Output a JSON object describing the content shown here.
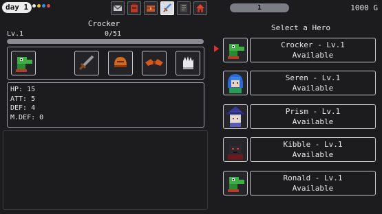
{
  "topbar": {
    "day_label": "day 1",
    "dot_colors": [
      "#e8e8e8",
      "#f2c230",
      "#3a8ee6",
      "#d84848"
    ],
    "tabs": [
      {
        "icon": "mail-icon",
        "active": false
      },
      {
        "icon": "backpack-icon",
        "active": false
      },
      {
        "icon": "chest-icon",
        "active": false
      },
      {
        "icon": "sword-icon",
        "active": true
      },
      {
        "icon": "notebook-icon",
        "active": false
      },
      {
        "icon": "house-icon",
        "active": false
      }
    ],
    "progress_value": "1",
    "gold": "1000 G"
  },
  "hero": {
    "name": "Crocker",
    "level": "Lv.1",
    "xp": "0/51",
    "portrait_icon": "crocodile-portrait-icon",
    "equipment": [
      {
        "icon": "sword-icon"
      },
      {
        "icon": "helmet-icon"
      },
      {
        "icon": "wing-armor-icon"
      },
      {
        "icon": "glove-icon"
      }
    ],
    "stats": [
      {
        "text": "HP: 15"
      },
      {
        "text": "ATT: 5"
      },
      {
        "text": "DEF: 4"
      },
      {
        "text": "M.DEF: 0"
      }
    ]
  },
  "hero_list": {
    "title": "Select a Hero",
    "selected_index": 0,
    "heroes": [
      {
        "name": "Crocker - Lv.1",
        "status": "Available",
        "portrait": "crocodile-portrait-icon"
      },
      {
        "name": "Seren - Lv.1",
        "status": "Available",
        "portrait": "blue-hair-portrait-icon"
      },
      {
        "name": "Prism - Lv.1",
        "status": "Available",
        "portrait": "witch-portrait-icon"
      },
      {
        "name": "Kibble - Lv.1",
        "status": "Available",
        "portrait": "dark-beast-portrait-icon"
      },
      {
        "name": "Ronald - Lv.1",
        "status": "Available",
        "portrait": "crocodile-portrait-icon"
      }
    ]
  }
}
